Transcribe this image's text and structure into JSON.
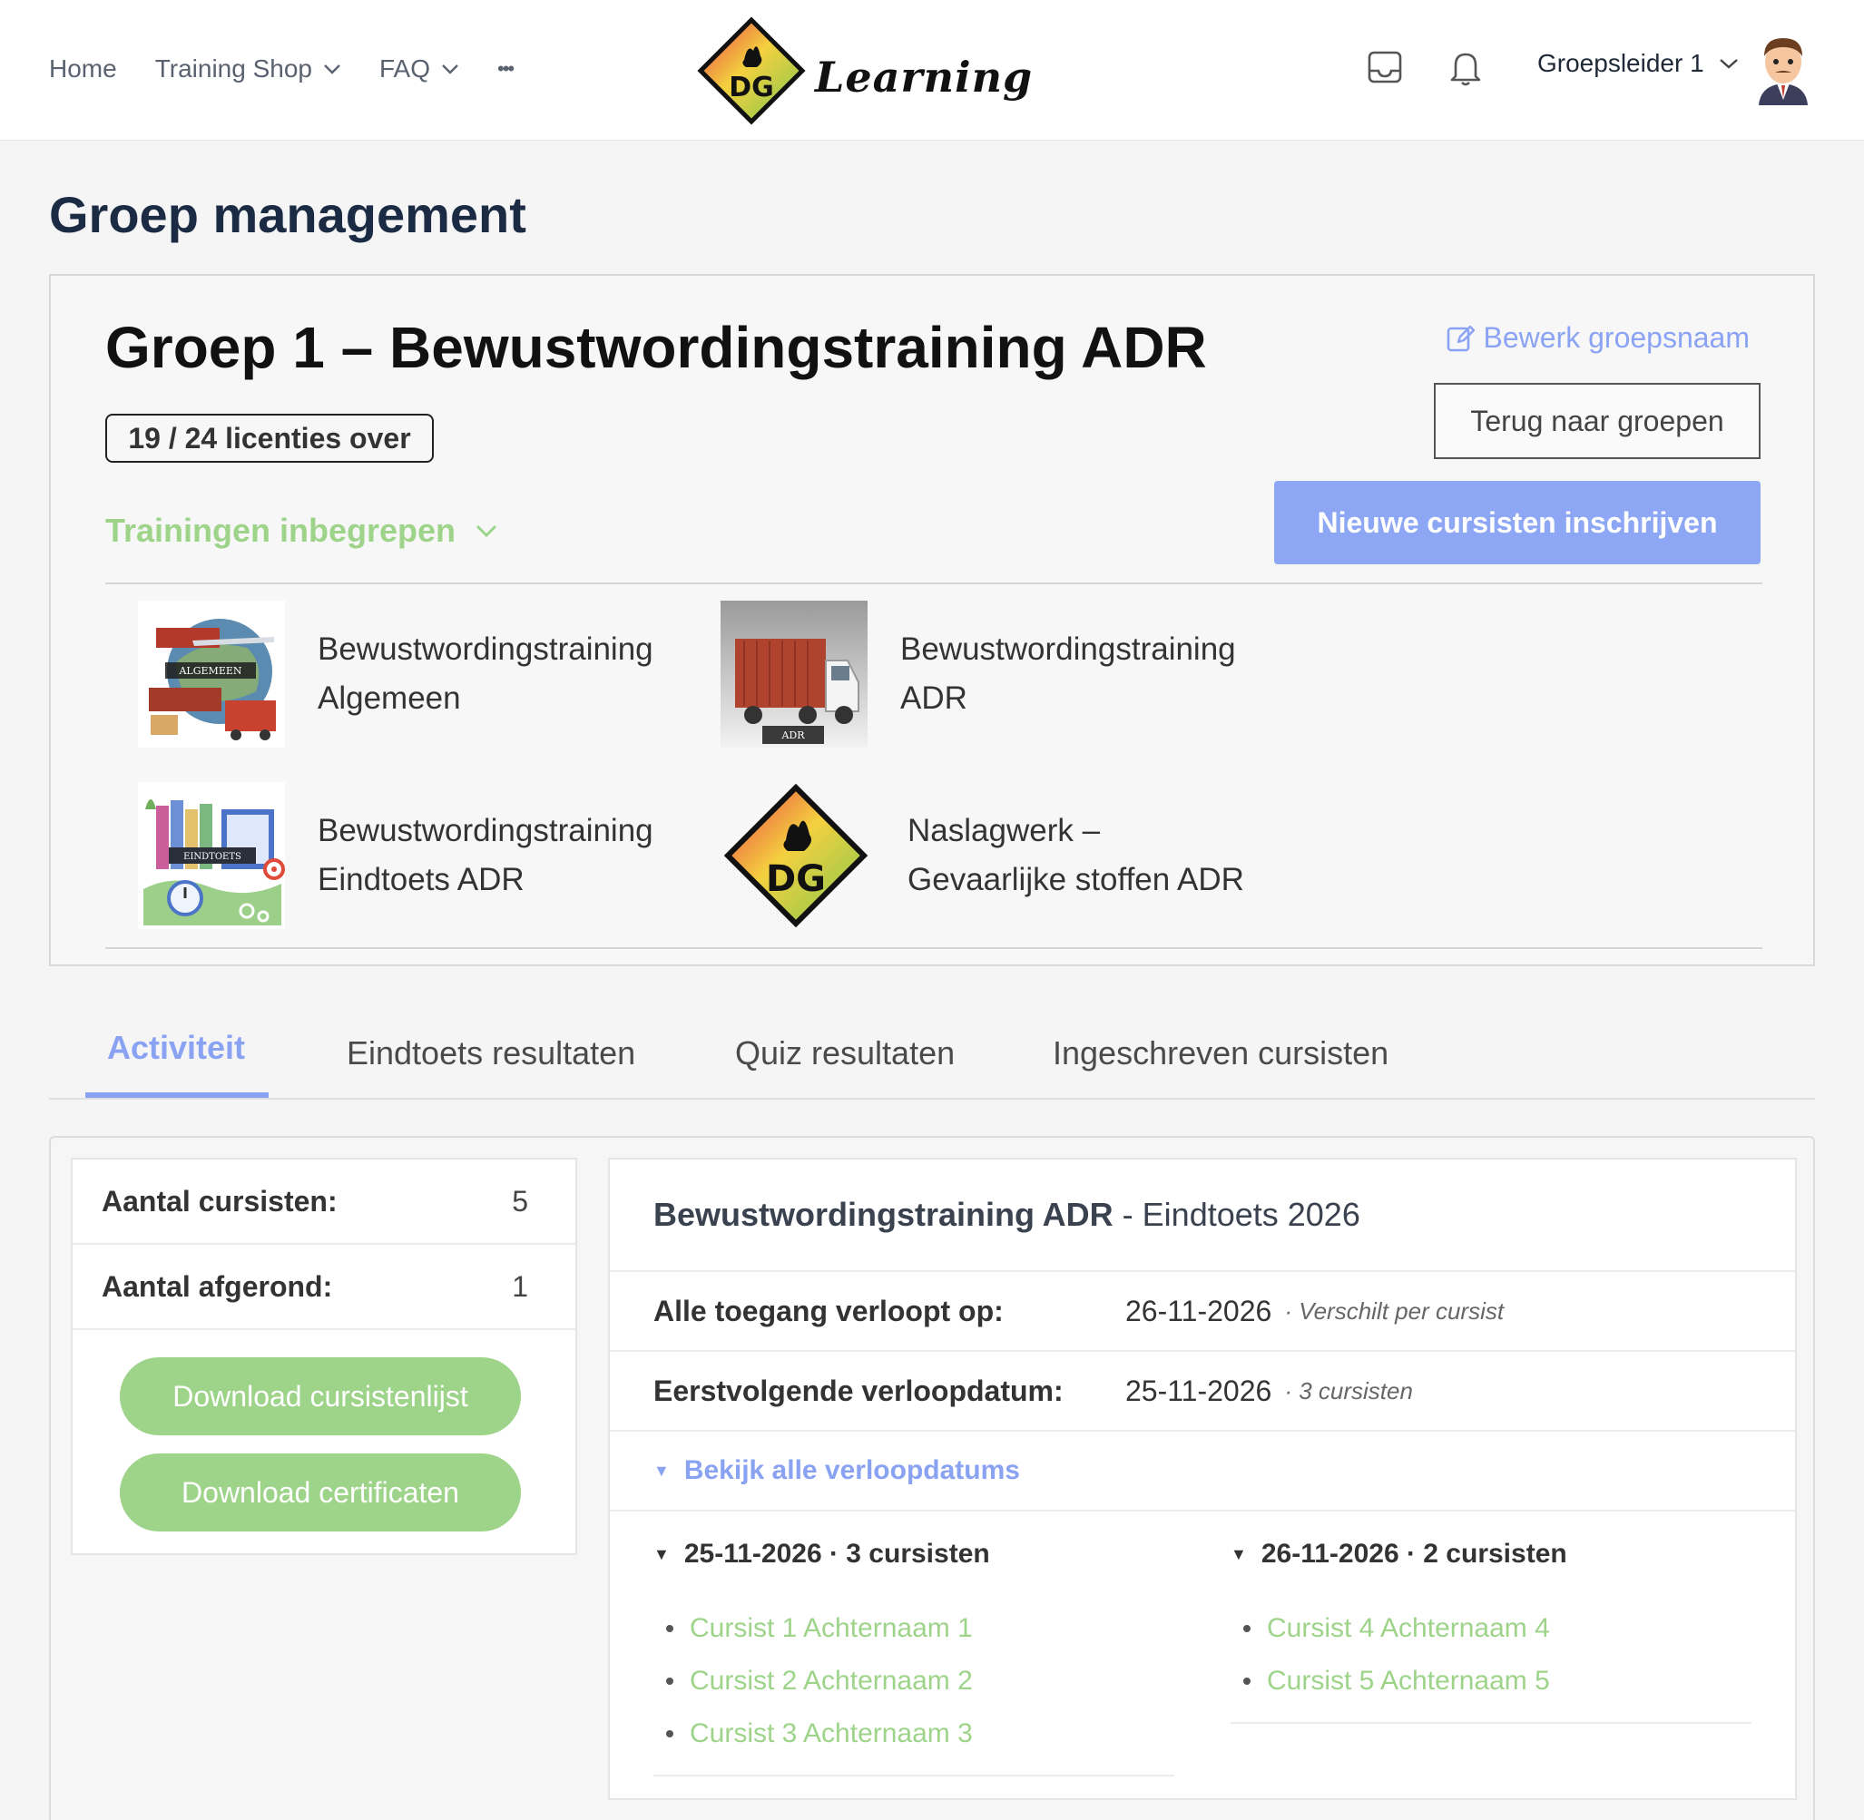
{
  "header": {
    "nav": [
      "Home",
      "Training Shop",
      "FAQ"
    ],
    "more_label": "•••",
    "logo_text": "Learning",
    "user_name": "Groepsleider 1"
  },
  "page": {
    "title": "Groep management"
  },
  "group": {
    "title": "Groep 1 – Bewustwordingstraining ADR",
    "licenses": "19 / 24 licenties over",
    "edit_label": "Bewerk groepsnaam",
    "back_label": "Terug naar groepen",
    "enroll_label": "Nieuwe cursisten inschrijven",
    "trainings_label": "Trainingen inbegrepen",
    "trainings": [
      {
        "line1": "Bewustwordingstraining",
        "line2": "Algemeen",
        "thumb_label": "ALGEMEEN"
      },
      {
        "line1": "Bewustwordingstraining",
        "line2": "ADR",
        "thumb_label": "ADR"
      },
      {
        "line1": "Bewustwordingstraining",
        "line2": "Eindtoets ADR",
        "thumb_label": "EINDTOETS"
      },
      {
        "line1": "Naslagwerk –",
        "line2": "Gevaarlijke stoffen ADR",
        "thumb_label": "DG"
      }
    ]
  },
  "tabs": [
    "Activiteit",
    "Eindtoets resultaten",
    "Quiz resultaten",
    "Ingeschreven cursisten"
  ],
  "stats": {
    "rows": [
      {
        "label": "Aantal cursisten:",
        "value": "5"
      },
      {
        "label": "Aantal afgerond:",
        "value": "1"
      }
    ],
    "download_list": "Download cursistenlijst",
    "download_certs": "Download certificaten"
  },
  "detail": {
    "title_strong": "Bewustwordingstraining ADR",
    "title_rest": " - Eindtoets 2026",
    "rows": [
      {
        "label": "Alle toegang verloopt op:",
        "value": "26-11-2026",
        "note": "· Verschilt per cursist"
      },
      {
        "label": "Eerstvolgende verloopdatum:",
        "value": "25-11-2026",
        "note": "· 3 cursisten"
      }
    ],
    "expand_label": "Bekijk alle verloopdatums",
    "groups": [
      {
        "title": "25-11-2026 · 3 cursisten",
        "students": [
          "Cursist 1 Achternaam 1",
          "Cursist 2 Achternaam 2",
          "Cursist 3 Achternaam 3"
        ]
      },
      {
        "title": "26-11-2026 · 2 cursisten",
        "students": [
          "Cursist 4 Achternaam 4",
          "Cursist 5 Achternaam 5"
        ]
      }
    ]
  },
  "colors": {
    "accent_blue": "#8da7f4",
    "accent_green": "#9ed48a",
    "title_navy": "#1c2b44"
  }
}
